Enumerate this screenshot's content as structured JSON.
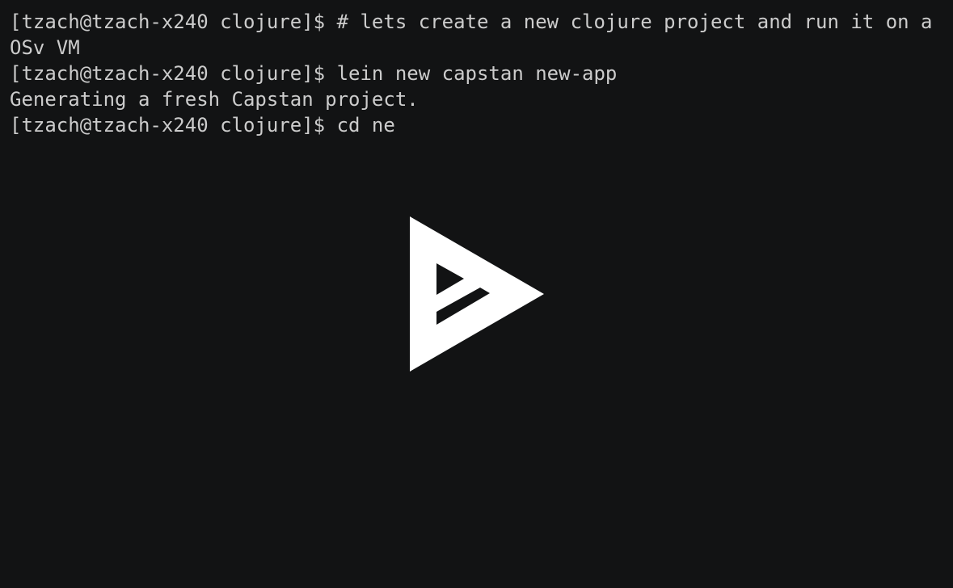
{
  "terminal": {
    "lines": [
      "[tzach@tzach-x240 clojure]$ # lets create a new clojure project and run it on a",
      "OSv VM",
      "[tzach@tzach-x240 clojure]$ lein new capstan new-app",
      "Generating a fresh Capstan project.",
      "[tzach@tzach-x240 clojure]$ cd ne"
    ]
  },
  "overlay": {
    "icon": "asciinema-play-icon",
    "icon_color": "#ffffff"
  },
  "colors": {
    "background": "#121314",
    "foreground": "#cccccc"
  }
}
